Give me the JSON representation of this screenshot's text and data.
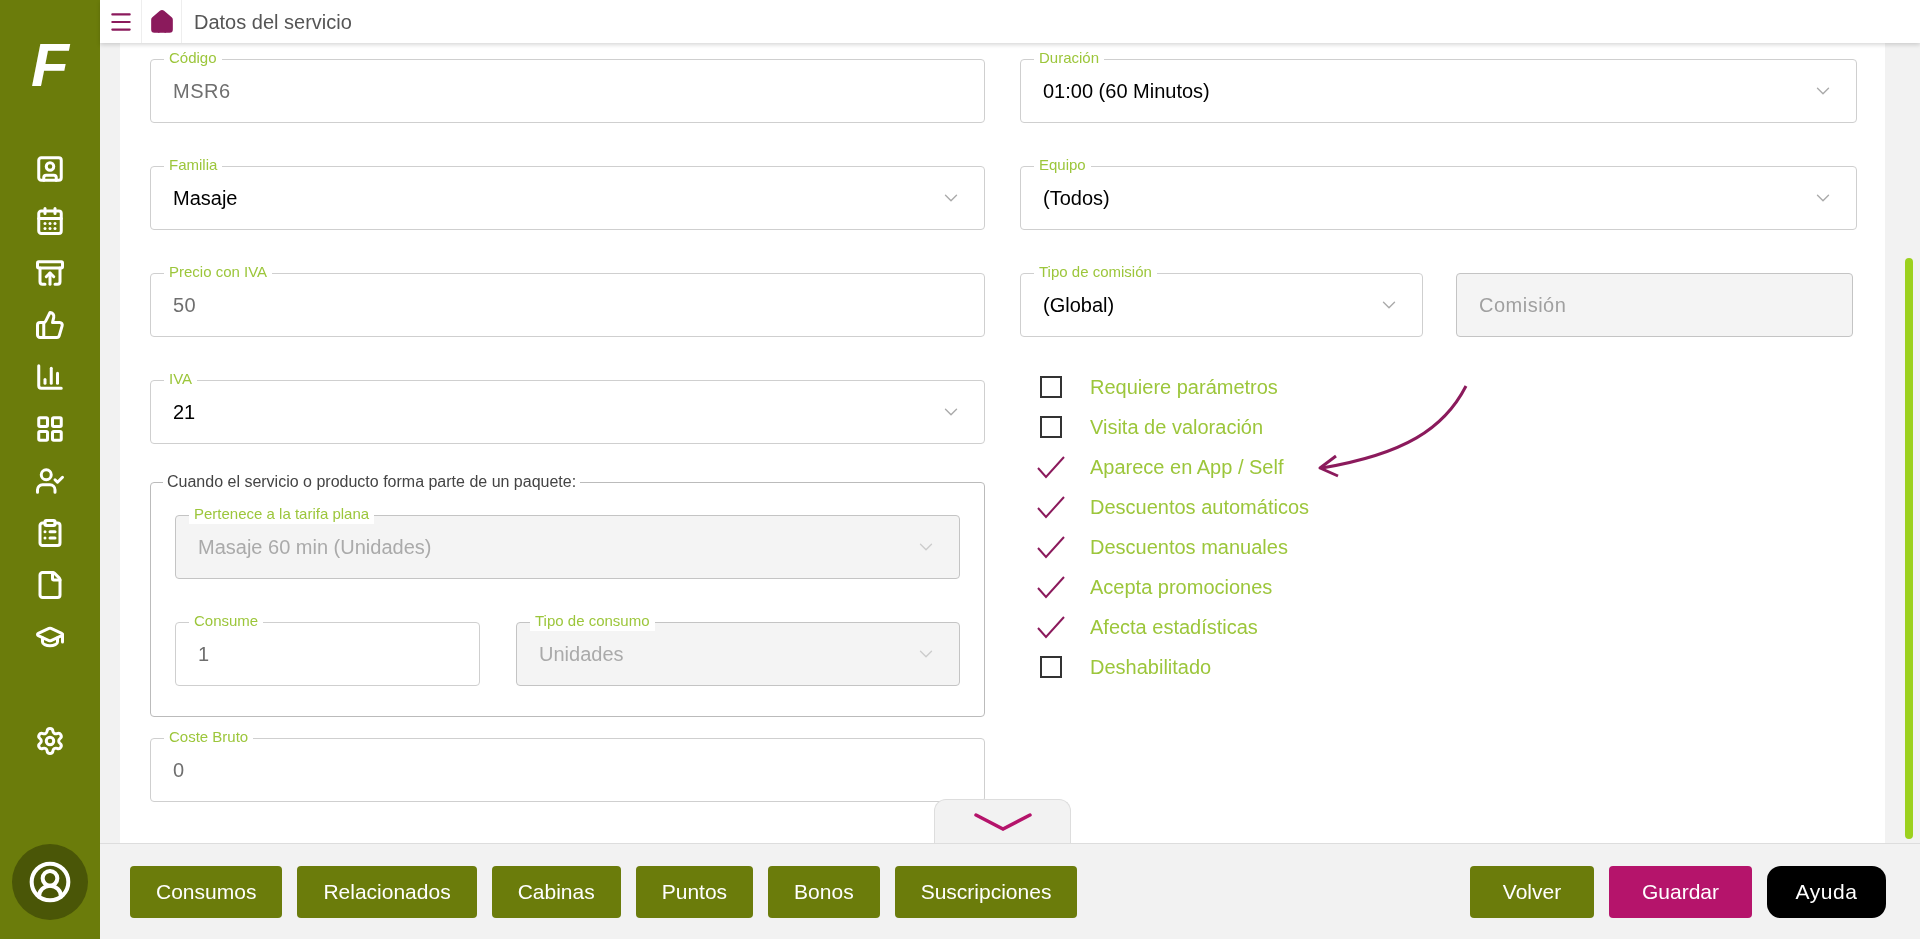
{
  "sidebar": {
    "logo": "F"
  },
  "header": {
    "title": "Datos del servicio"
  },
  "left_fields": [
    {
      "kind": "text",
      "label": "Código",
      "value": "MSR6",
      "disabled": false
    },
    {
      "kind": "select",
      "label": "Familia",
      "value": "Masaje",
      "disabled": false
    },
    {
      "kind": "text",
      "label": "Precio con IVA",
      "value": "50",
      "disabled": false
    },
    {
      "kind": "select",
      "label": "IVA",
      "value": "21",
      "disabled": false
    }
  ],
  "package_group": {
    "legend": "Cuando el servicio o producto forma parte de un paquete:",
    "fields": [
      {
        "kind": "select",
        "label": "Pertenece a la tarifa plana",
        "value": "Masaje 60 min (Unidades)",
        "disabled": true
      },
      {
        "kind": "text",
        "label": "Consume",
        "value": "1",
        "disabled": false
      },
      {
        "kind": "select",
        "label": "Tipo de consumo",
        "value": "Unidades",
        "disabled": true
      }
    ]
  },
  "cost_field": {
    "kind": "text",
    "label": "Coste Bruto",
    "value": "0",
    "disabled": false
  },
  "right_fields": [
    {
      "kind": "select",
      "label": "Duración",
      "value": "01:00 (60 Minutos)",
      "disabled": false
    },
    {
      "kind": "select",
      "label": "Equipo",
      "value": "(Todos)",
      "disabled": false
    }
  ],
  "commission": {
    "type_field": {
      "kind": "select",
      "label": "Tipo de comisión",
      "value": "(Global)",
      "disabled": false
    },
    "amount_field": {
      "kind": "text",
      "placeholder": "Comisión",
      "disabled": true
    }
  },
  "options": [
    {
      "label": "Requiere parámetros",
      "checked": false
    },
    {
      "label": "Visita de valoración",
      "checked": false
    },
    {
      "label": "Aparece en App / Self",
      "checked": true
    },
    {
      "label": "Descuentos automáticos",
      "checked": true
    },
    {
      "label": "Descuentos manuales",
      "checked": true
    },
    {
      "label": "Acepta promociones",
      "checked": true
    },
    {
      "label": "Afecta estadísticas",
      "checked": true
    },
    {
      "label": "Deshabilitado",
      "checked": false
    }
  ],
  "tab_buttons": [
    "Consumos",
    "Relacionados",
    "Cabinas",
    "Puntos",
    "Bonos",
    "Suscripciones"
  ],
  "action_buttons": [
    {
      "kind": "secondary",
      "label": "Volver"
    },
    {
      "kind": "primary",
      "label": "Guardar"
    },
    {
      "kind": "help",
      "label": "Ayuda"
    }
  ]
}
